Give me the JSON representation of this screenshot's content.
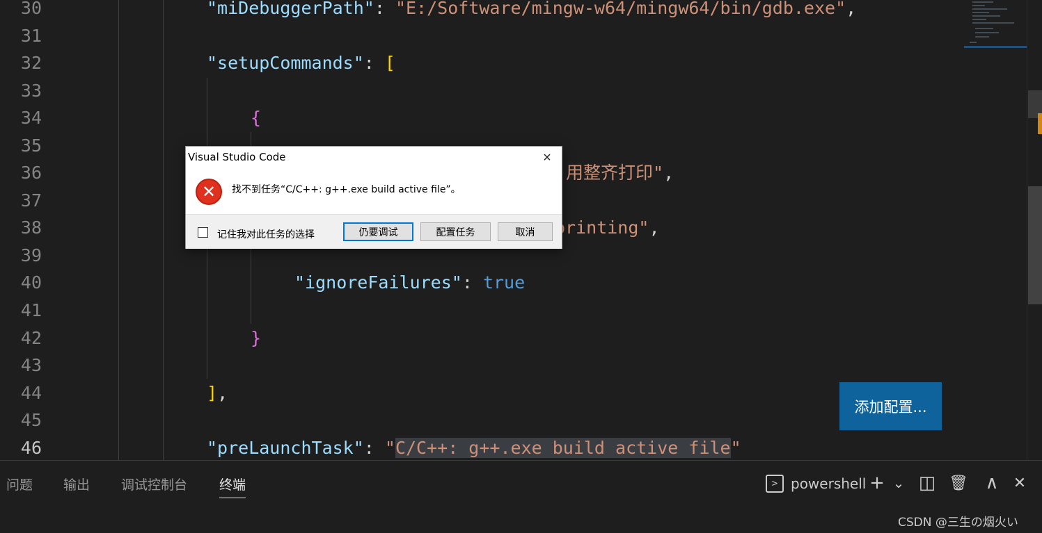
{
  "editor": {
    "line_numbers": [
      "30",
      "31",
      "32",
      "33",
      "34",
      "35",
      "36",
      "37",
      "38",
      "39",
      "40",
      "41",
      "42",
      "43",
      "44",
      "45",
      "46"
    ],
    "active_line": "46",
    "lines": {
      "l30": {
        "key": "\"miDebuggerPath\"",
        "sep": ": ",
        "value": "\"E:/Software/mingw-w64/mingw64/bin/gdb.exe\"",
        "end": ","
      },
      "l32": {
        "key": "\"setupCommands\"",
        "sep": ": ",
        "bracket": "["
      },
      "l34": {
        "brace": "{"
      },
      "l36": {
        "value": "用整齐打印\"",
        "end": ","
      },
      "l38": {
        "value": "printing\"",
        "end": ","
      },
      "l40": {
        "key": "\"ignoreFailures\"",
        "sep": ": ",
        "value": "true"
      },
      "l42": {
        "brace": "}"
      },
      "l44": {
        "bracket": "]",
        "end": ","
      },
      "l46": {
        "key": "\"preLaunchTask\"",
        "sep": ": ",
        "quote": "\"",
        "value": "C/C++: g++.exe build active file",
        "end_quote": "\""
      }
    },
    "add_config_label": "添加配置..."
  },
  "dialog": {
    "title": "Visual Studio Code",
    "close_icon": "×",
    "error_icon": "✕",
    "message": "找不到任务“C/C++: g++.exe build active file”。",
    "checkbox_label": "记住我对此任务的选择",
    "buttons": {
      "debug_anyway": "仍要调试",
      "configure_task": "配置任务",
      "cancel": "取消"
    }
  },
  "panel": {
    "tabs": [
      "问题",
      "输出",
      "调试控制台",
      "终端"
    ],
    "active_tab": "终端",
    "terminal_icon": ">",
    "terminal_name": "powershell",
    "icons": {
      "add": "+",
      "dropdown": "⌄",
      "split": "◫",
      "trash": "🗑",
      "maximize": "∧",
      "close": "✕"
    }
  },
  "watermark": "CSDN @三生の烟火い",
  "colors": {
    "editor_bg": "#1e1e1e",
    "key": "#9cdcfe",
    "string": "#ce9178",
    "boolean": "#569cd6",
    "bracket_yellow": "#ffd700",
    "bracket_purple": "#da70d6",
    "button_blue": "#0e639c",
    "error_red": "#e0301e"
  }
}
